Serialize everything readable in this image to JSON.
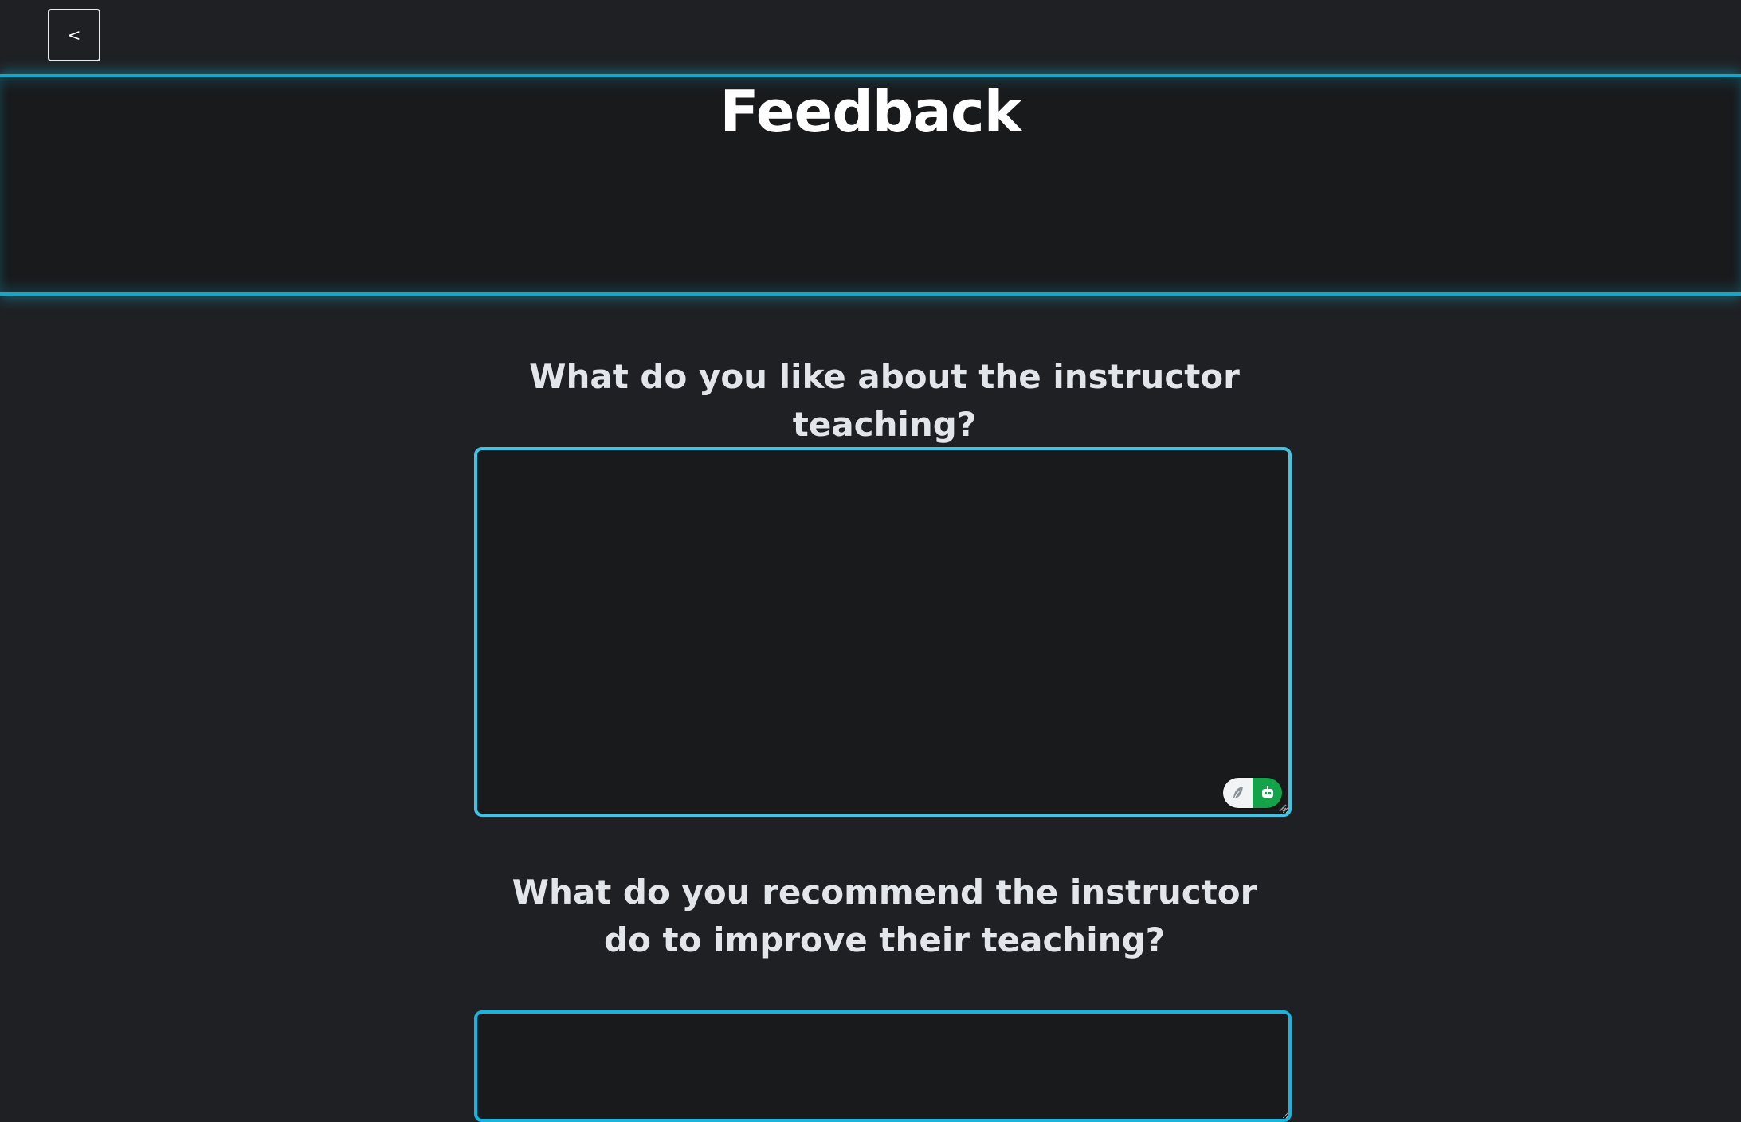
{
  "nav": {
    "back_label": "<"
  },
  "header": {
    "title": "Feedback"
  },
  "form": {
    "questions": [
      {
        "label": "What do you like about the instructor teaching?",
        "value": ""
      },
      {
        "label": "What do you recommend the instructor do to improve their teaching?",
        "value": ""
      }
    ],
    "writing_assistant_icons": [
      "feather-icon",
      "robot-icon"
    ]
  },
  "colors": {
    "accent": "#16a6c8",
    "input_border": "#40c4e6",
    "background": "#1f2023",
    "banner_background": "#191a1c",
    "assistant_green": "#14a34a"
  }
}
